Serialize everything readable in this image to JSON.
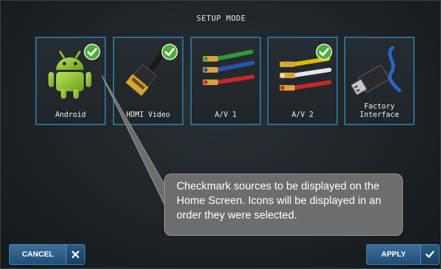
{
  "header": {
    "title": "SETUP MODE"
  },
  "sources": [
    {
      "label": "Android",
      "icon": "android-icon",
      "checked": true
    },
    {
      "label": "HDMI Video",
      "icon": "hdmi-cable-icon",
      "checked": true
    },
    {
      "label": "A/V 1",
      "icon": "av-cables-icon",
      "checked": false
    },
    {
      "label": "A/V 2",
      "icon": "rca-cables-icon",
      "checked": true
    },
    {
      "label": "Factory\nInterface",
      "icon": "usb-cable-icon",
      "checked": false
    }
  ],
  "callout": {
    "text": "Checkmark sources to be displayed on the Home Screen. Icons will be displayed in an order they were selected."
  },
  "buttons": {
    "cancel": "CANCEL",
    "apply": "APPLY"
  },
  "colors": {
    "tile_border": "#2f6f98",
    "check_green": "#4cae3c",
    "button_blue": "#2c5d86",
    "callout_gray": "#6d6d6d"
  }
}
